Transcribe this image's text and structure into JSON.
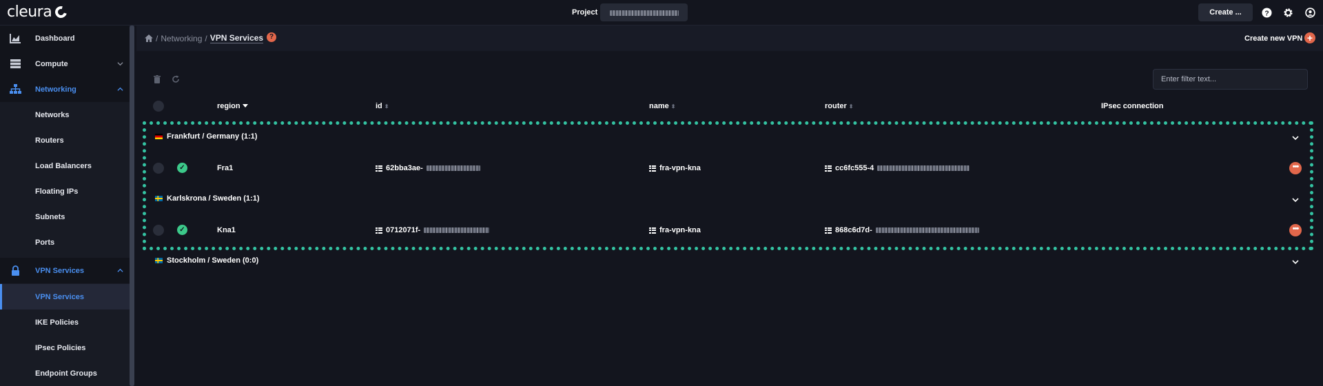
{
  "brand": {
    "name": "cleura"
  },
  "topbar": {
    "project_label": "Project",
    "create_label": "Create ...",
    "icons": [
      "help-icon",
      "gear-icon",
      "user-icon"
    ]
  },
  "sidebar": {
    "items": [
      {
        "label": "Dashboard",
        "icon": "chart-icon"
      },
      {
        "label": "Compute",
        "icon": "server-icon"
      },
      {
        "label": "Networking",
        "icon": "network-icon"
      },
      {
        "label": "Networks"
      },
      {
        "label": "Routers"
      },
      {
        "label": "Load Balancers"
      },
      {
        "label": "Floating IPs"
      },
      {
        "label": "Subnets"
      },
      {
        "label": "Ports"
      },
      {
        "label": "VPN Services",
        "icon": "lock-icon"
      },
      {
        "label": "VPN Services"
      },
      {
        "label": "IKE Policies"
      },
      {
        "label": "IPsec Policies"
      },
      {
        "label": "Endpoint Groups"
      }
    ]
  },
  "breadcrumb": {
    "sep1": "/",
    "networking": "Networking",
    "sep2": "/",
    "current": "VPN Services"
  },
  "header": {
    "help": "?",
    "create_new": "Create new VPN",
    "plus": "+"
  },
  "filter": {
    "placeholder": "Enter filter text..."
  },
  "table": {
    "columns": {
      "region": "region",
      "id": "id",
      "name": "name",
      "router": "router",
      "ipsec": "IPsec connection"
    },
    "groups": [
      {
        "label": "Frankfurt / Germany (1:1)",
        "flag": "de",
        "row": {
          "region": "Fra1",
          "id": "62bba3ae-",
          "name": "fra-vpn-kna",
          "router": "cc6fc555-4"
        }
      },
      {
        "label": "Karlskrona / Sweden (1:1)",
        "flag": "se",
        "row": {
          "region": "Kna1",
          "id": "0712071f-",
          "name": "fra-vpn-kna",
          "router": "868c6d7d-"
        }
      },
      {
        "label": "Stockholm / Sweden (0:0)",
        "flag": "se"
      }
    ]
  },
  "colors": {
    "accent": "#4a8ff0",
    "danger": "#e2674b",
    "success": "#3cc98a",
    "highlight": "#34c3a2"
  }
}
